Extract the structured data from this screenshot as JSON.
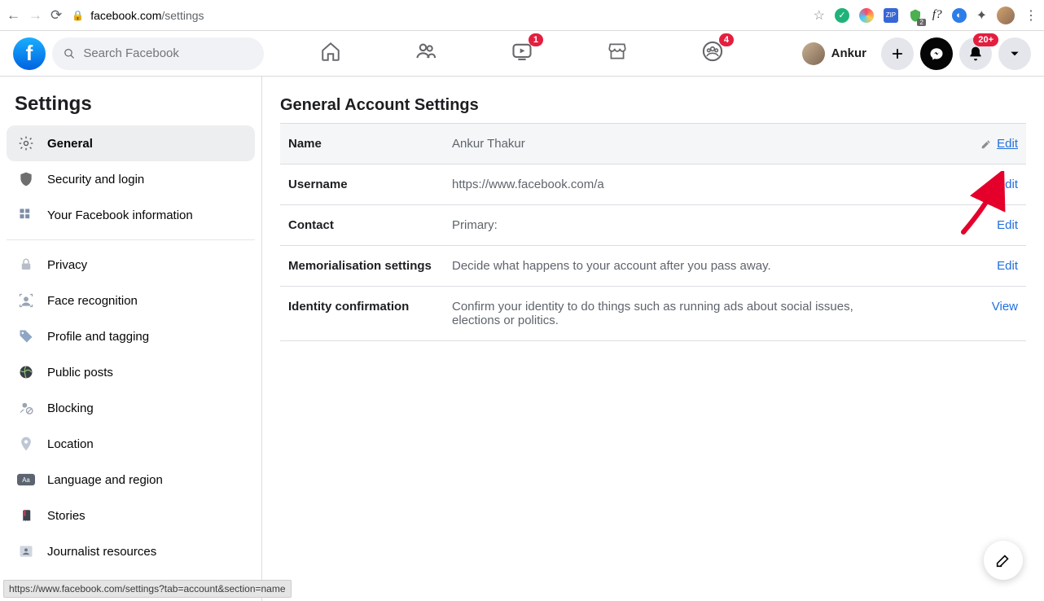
{
  "browser": {
    "url_domain": "facebook.com",
    "url_path": "/settings",
    "status_url": "https://www.facebook.com/settings?tab=account&section=name"
  },
  "header": {
    "search_placeholder": "Search Facebook",
    "user_name": "Ankur",
    "video_badge": "1",
    "groups_badge": "4",
    "notif_badge": "20+"
  },
  "sidebar": {
    "title": "Settings",
    "group1": [
      {
        "icon": "gear-icon",
        "label": "General",
        "active": true
      },
      {
        "icon": "shield-icon",
        "label": "Security and login"
      },
      {
        "icon": "grid-icon",
        "label": "Your Facebook information"
      }
    ],
    "group2": [
      {
        "icon": "lock-icon",
        "label": "Privacy"
      },
      {
        "icon": "face-icon",
        "label": "Face recognition"
      },
      {
        "icon": "tag-icon",
        "label": "Profile and tagging"
      },
      {
        "icon": "globe-icon",
        "label": "Public posts"
      },
      {
        "icon": "person-block-icon",
        "label": "Blocking"
      },
      {
        "icon": "location-pin-icon",
        "label": "Location"
      },
      {
        "icon": "language-icon",
        "label": "Language and region"
      },
      {
        "icon": "book-icon",
        "label": "Stories"
      },
      {
        "icon": "journalist-icon",
        "label": "Journalist resources"
      }
    ]
  },
  "main": {
    "title": "General Account Settings",
    "rows": [
      {
        "label": "Name",
        "value": "Ankur Thakur",
        "action": "Edit",
        "highlight": true,
        "pencil": true
      },
      {
        "label": "Username",
        "value": "https://www.facebook.com/a",
        "action": "Edit"
      },
      {
        "label": "Contact",
        "value": "Primary:",
        "action": "Edit"
      },
      {
        "label": "Memorialisation settings",
        "value": "Decide what happens to your account after you pass away.",
        "action": "Edit"
      },
      {
        "label": "Identity confirmation",
        "value": "Confirm your identity to do things such as running ads about social issues, elections or politics.",
        "action": "View"
      }
    ]
  }
}
